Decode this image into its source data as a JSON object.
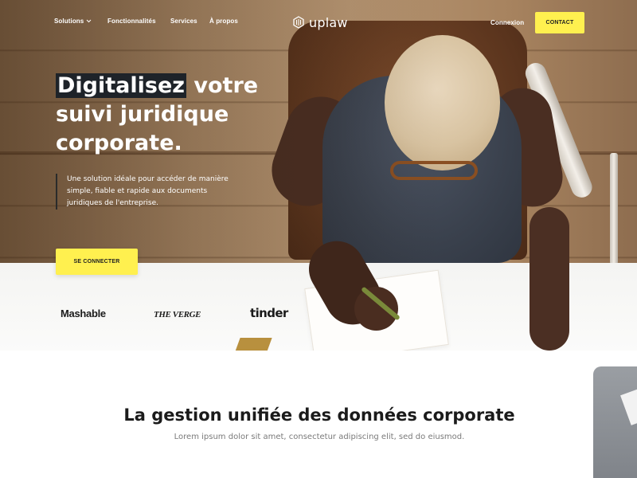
{
  "nav": {
    "items": [
      {
        "label": "Solutions",
        "has_dropdown": true
      },
      {
        "label": "Fonctionnalités"
      },
      {
        "label": "Services"
      },
      {
        "label": "À propos"
      }
    ],
    "login_label": "Connexion",
    "contact_label": "CONTACT"
  },
  "brand": {
    "name": "uplaw",
    "logo_icon": "hexagon-stripes-icon",
    "accent_color": "#fff04f"
  },
  "hero": {
    "headline_highlight": "Digitalisez",
    "headline_rest_1": " votre",
    "headline_line_2": "suivi juridique",
    "headline_line_3": "corporate.",
    "subtitle": "Une solution idéale pour accéder de manière simple, fiable et rapide aux documents juridiques de l'entreprise.",
    "cta_label": "SE CONNECTER"
  },
  "press_logos": [
    "Mashable",
    "THE VERGE",
    "tinder"
  ],
  "section": {
    "title": "La gestion unifiée des données corporate",
    "subtitle": "Lorem ipsum dolor sit amet, consectetur adipiscing elit, sed do eiusmod."
  }
}
